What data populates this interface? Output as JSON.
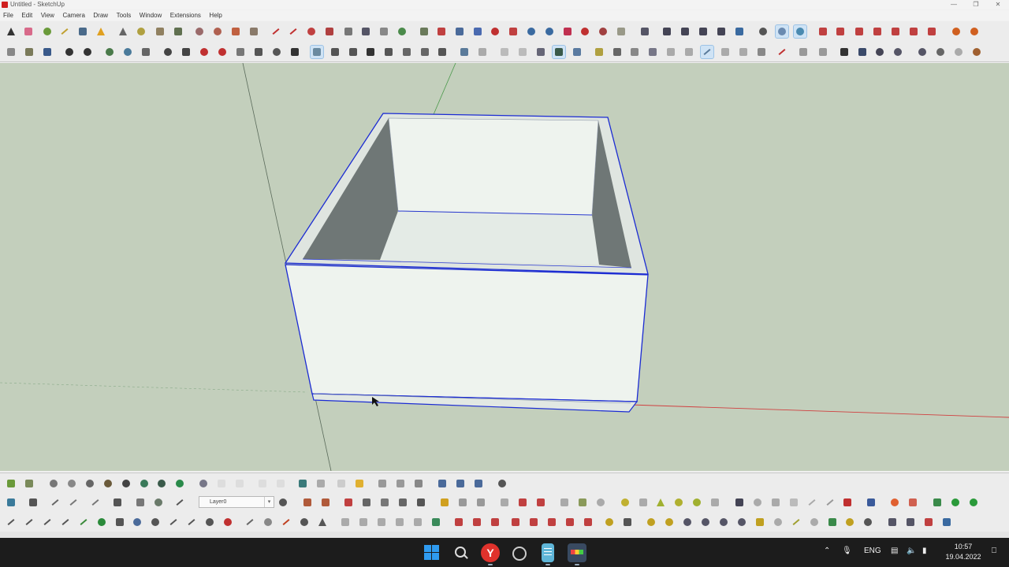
{
  "window": {
    "title": "Untitled - SketchUp"
  },
  "menu": [
    "File",
    "Edit",
    "View",
    "Camera",
    "Draw",
    "Tools",
    "Window",
    "Extensions",
    "Help"
  ],
  "layer": {
    "current": "Layer0"
  },
  "taskbar": {
    "language": "ENG",
    "time": "10:57",
    "date": "19.04.2022",
    "yandex_glyph": "Y"
  },
  "colors": {
    "viewport": "#c3cfbc",
    "model_face": "#eef3ee",
    "model_inner_shadow": "#6f7776",
    "selection_edge": "#1b2bd3",
    "axis_red": "#d04040",
    "axis_green": "#40a040"
  }
}
